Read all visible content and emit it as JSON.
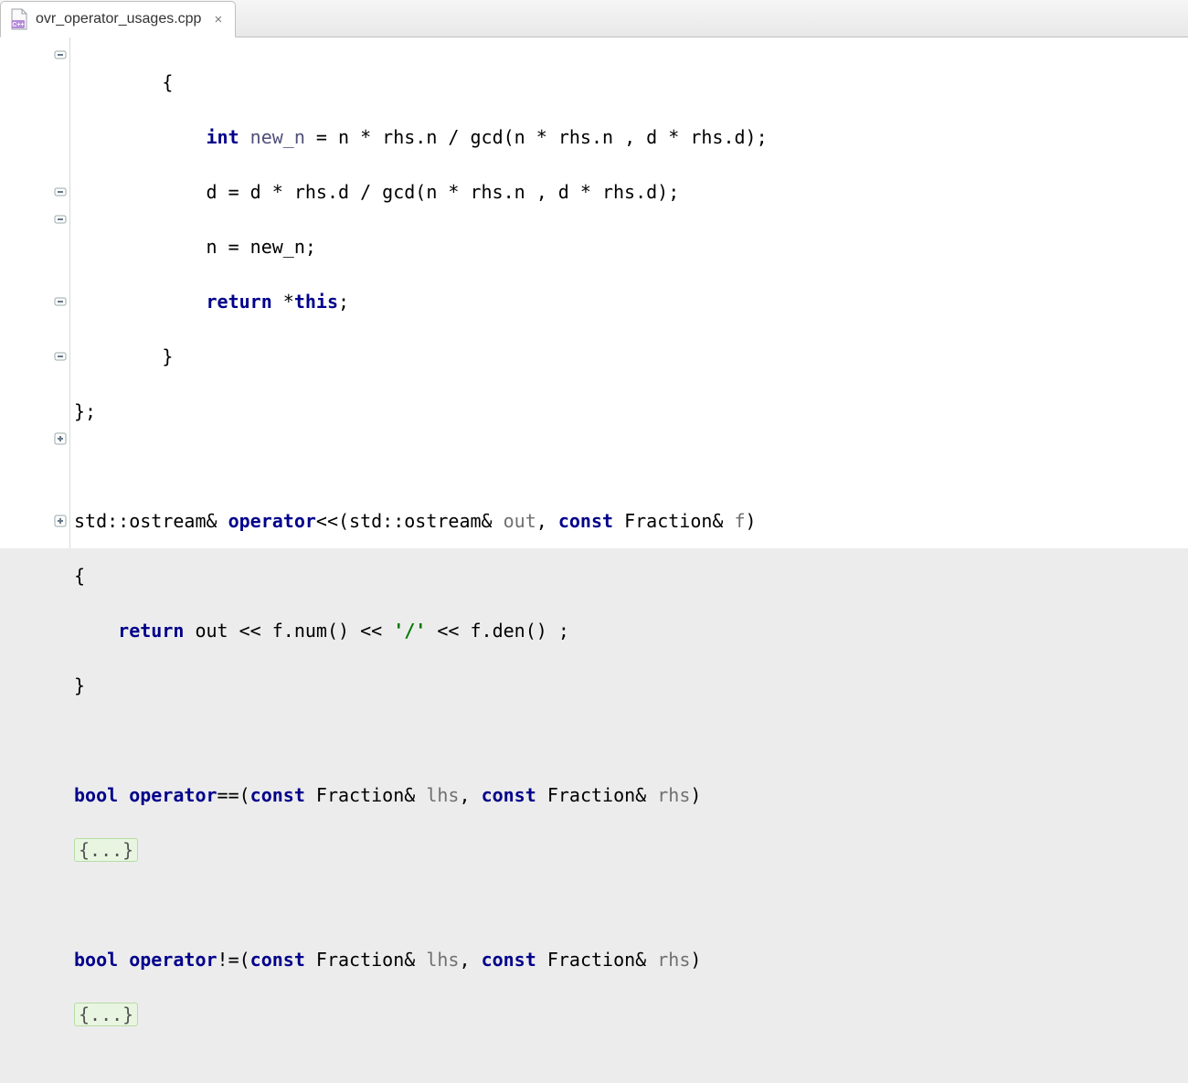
{
  "tab": {
    "filename": "ovr_operator_usages.cpp",
    "close_glyph": "×"
  },
  "code": {
    "l1": "        {",
    "l2_pre": "            ",
    "l2_kw": "int",
    "l2_sp": " ",
    "l2_id1": "new_n",
    "l2_rest": " = n * rhs.n / gcd(n * rhs.n , d * rhs.d);",
    "l3": "            d = d * rhs.d / gcd(n * rhs.n , d * rhs.d);",
    "l4": "            n = new_n;",
    "l5_pre": "            ",
    "l5_kw1": "return",
    "l5_mid": " *",
    "l5_kw2": "this",
    "l5_end": ";",
    "l6": "        }",
    "l7": "};",
    "l8": "",
    "l9_a": "std::ostream& ",
    "l9_b": "operator",
    "l9_c": "<<(std::ostream& ",
    "l9_d": "out",
    "l9_e": ", ",
    "l9_f": "const",
    "l9_g": " Fraction& ",
    "l9_h": "f",
    "l9_i": ")",
    "l10": "{",
    "l11_pre": "    ",
    "l11_kw": "return",
    "l11_a": " out << f.num() << ",
    "l11_s": "'/'",
    "l11_b": " << f.den() ;",
    "l12": "}",
    "l13": "",
    "l14_a": "bool",
    "l14_b": " ",
    "l14_c": "operator",
    "l14_d": "==(",
    "l14_e": "const",
    "l14_f": " Fraction& ",
    "l14_g": "lhs",
    "l14_h": ", ",
    "l14_i": "const",
    "l14_j": " Fraction& ",
    "l14_k": "rhs",
    "l14_l": ")",
    "l15_fold": "{...}",
    "l16": "",
    "l17_a": "bool",
    "l17_b": " ",
    "l17_c": "operator",
    "l17_d": "!=(",
    "l17_e": "const",
    "l17_f": " Fraction& ",
    "l17_g": "lhs",
    "l17_h": ", ",
    "l17_i": "const",
    "l17_j": " Fraction& ",
    "l17_k": "rhs",
    "l17_l": ")",
    "l18_fold": "{...}"
  }
}
